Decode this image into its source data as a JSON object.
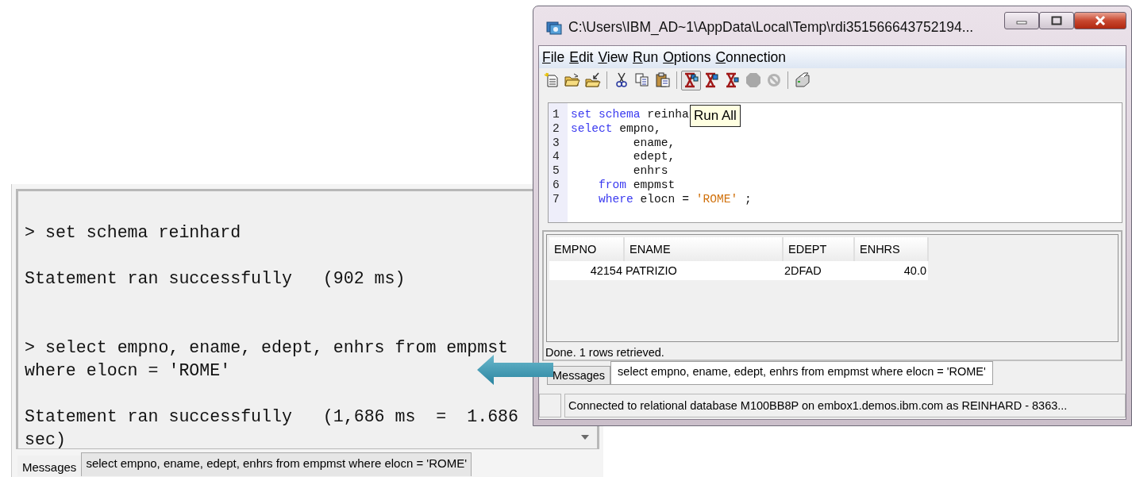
{
  "zoomed_messages": {
    "entries": [
      {
        "kind": "command",
        "lines": [
          "> set schema reinhard"
        ]
      },
      {
        "kind": "result",
        "lines": [
          "Statement ran successfully   (902 ms)"
        ]
      },
      {
        "kind": "command",
        "lines": [
          "> select empno, ename, edept, enhrs from empmst",
          "where elocn = 'ROME'"
        ]
      },
      {
        "kind": "result",
        "lines": [
          "Statement ran successfully   (1,686 ms  =  1.686",
          "sec)"
        ]
      }
    ],
    "tab": "Messages",
    "message": "select empno, ename, edept, enhrs from empmst where elocn = 'ROME'"
  },
  "window": {
    "title": "C:\\Users\\IBM_AD~1\\AppData\\Local\\Temp\\rdi351566643752194...",
    "menu": [
      "File",
      "Edit",
      "View",
      "Run",
      "Options",
      "Connection"
    ],
    "toolbar": [
      {
        "kind": "new",
        "disabled": false,
        "highlighted": false
      },
      {
        "kind": "open",
        "disabled": false,
        "highlighted": false
      },
      {
        "kind": "import",
        "disabled": false,
        "highlighted": false
      },
      {
        "kind": "separator"
      },
      {
        "kind": "cut",
        "disabled": false,
        "highlighted": false
      },
      {
        "kind": "copy",
        "disabled": false,
        "highlighted": false
      },
      {
        "kind": "paste",
        "disabled": false,
        "highlighted": false
      },
      {
        "kind": "separator"
      },
      {
        "kind": "run-all",
        "disabled": false,
        "highlighted": true
      },
      {
        "kind": "run-selected",
        "disabled": false,
        "highlighted": false
      },
      {
        "kind": "run-one",
        "disabled": false,
        "highlighted": false
      },
      {
        "kind": "stop",
        "disabled": true,
        "highlighted": false
      },
      {
        "kind": "cancel",
        "disabled": true,
        "highlighted": false
      },
      {
        "kind": "separator"
      },
      {
        "kind": "print",
        "disabled": false,
        "highlighted": false
      }
    ],
    "tooltip": "Run All",
    "editor": [
      {
        "number": "1",
        "tokens": [
          {
            "kind": "keyword",
            "text": "set schema"
          },
          {
            "kind": "plain",
            "text": " reinha"
          }
        ]
      },
      {
        "number": "2",
        "tokens": [
          {
            "kind": "keyword",
            "text": "select"
          },
          {
            "kind": "plain",
            "text": " empno,"
          }
        ]
      },
      {
        "number": "3",
        "tokens": [
          {
            "kind": "plain",
            "text": "         ename,"
          }
        ]
      },
      {
        "number": "4",
        "tokens": [
          {
            "kind": "plain",
            "text": "         edept,"
          }
        ]
      },
      {
        "number": "5",
        "tokens": [
          {
            "kind": "plain",
            "text": "         enhrs"
          }
        ]
      },
      {
        "number": "6",
        "tokens": [
          {
            "kind": "keyword",
            "text": "    from"
          },
          {
            "kind": "plain",
            "text": " empmst"
          }
        ]
      },
      {
        "number": "7",
        "tokens": [
          {
            "kind": "keyword",
            "text": "    where"
          },
          {
            "kind": "plain",
            "text": " elocn = "
          },
          {
            "kind": "string",
            "text": "'ROME'"
          },
          {
            "kind": "plain",
            "text": " ;"
          }
        ]
      }
    ],
    "results": {
      "columns": [
        "EMPNO",
        "ENAME",
        "EDEPT",
        "ENHRS"
      ],
      "rows": [
        [
          "42154",
          "PATRIZIO",
          "2DFAD",
          "40.0"
        ]
      ]
    },
    "result_status": "Done. 1 rows retrieved.",
    "tab": "Messages",
    "message": "select empno, ename, edept, enhrs from empmst where elocn = 'ROME'",
    "status_bar": "Connected to relational database M100BB8P on embox1.demos.ibm.com as REINHARD - 8363..."
  }
}
